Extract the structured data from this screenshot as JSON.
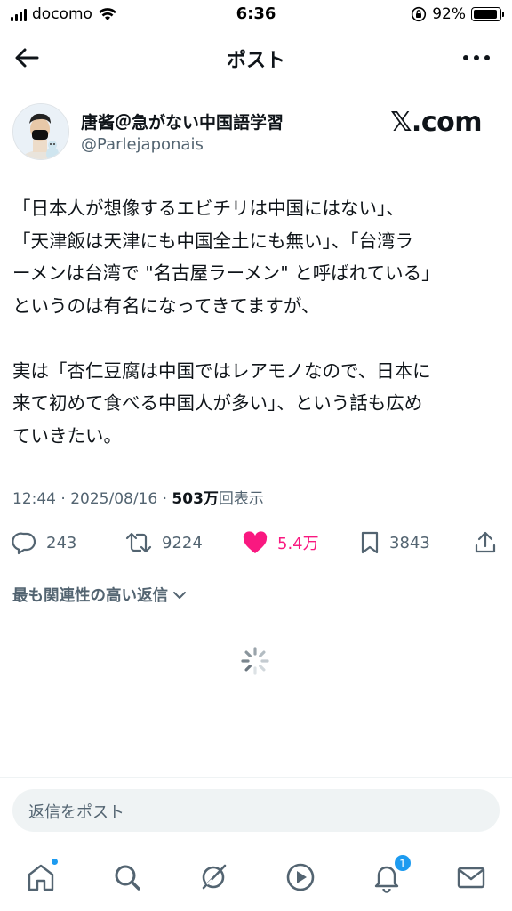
{
  "status_bar": {
    "carrier": "docomo",
    "time": "6:36",
    "battery_percent": "92%",
    "battery_level": 0.92
  },
  "header": {
    "title": "ポスト"
  },
  "author": {
    "name": "唐酱＠急がない中国語学習",
    "handle": "@Parlejaponais",
    "logo_text": "𝕏.com"
  },
  "post": {
    "lines_para1": [
      "「日本人が想像するエビチリは中国にはない」、",
      "「天津飯は天津にも中国全土にも無い」、「台湾ラ",
      "ーメンは台湾で \"名古屋ラーメン\" と呼ばれている」",
      "というのは有名になってきてますが、"
    ],
    "lines_para2": [
      "実は「杏仁豆腐は中国ではレアモノなので、日本に",
      "来て初めて食べる中国人が多い」、という話も広め",
      "ていきたい。"
    ],
    "timestamp": "12:44 · 2025/08/16 · ",
    "views_number": "503万",
    "views_label": "回表示"
  },
  "actions": {
    "replies": "243",
    "reposts": "9224",
    "likes": "5.4万",
    "bookmarks": "3843"
  },
  "replies_sort": {
    "label": "最も関連性の高い返信"
  },
  "reply_input": {
    "placeholder": "返信をポスト"
  },
  "bottom_nav": {
    "notifications_count": "1"
  },
  "colors": {
    "like": "#f91880",
    "accent": "#1d9bf0",
    "secondary_text": "#536471"
  }
}
